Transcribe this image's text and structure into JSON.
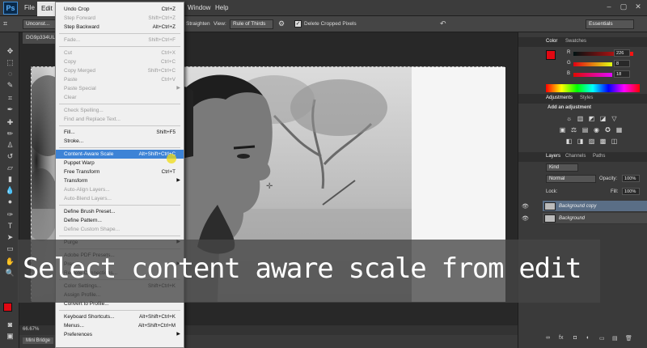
{
  "menubar": {
    "app_logo": "Ps",
    "items": [
      {
        "label": "File",
        "active": false
      },
      {
        "label": "Edit",
        "active": true
      },
      {
        "label": "Window",
        "active": false
      },
      {
        "label": "Help",
        "active": false
      }
    ],
    "window_controls": [
      "–",
      "▢",
      "✕"
    ]
  },
  "options_bar": {
    "ratio_value": "Unconst...",
    "straighten_label": "Straighten",
    "view_label": "View:",
    "view_value": "Rule of Thirds",
    "delete_cropped_label": "Delete Cropped Pixels",
    "workspace_value": "Essentials"
  },
  "document": {
    "tab_title": "DG9p334UL...",
    "zoom": "66.67%",
    "mini_bridge_label": "Mini Bridge"
  },
  "edit_menu": {
    "rows": [
      {
        "label": "Undo Crop",
        "shortcut": "Ctrl+Z",
        "state": "enabled"
      },
      {
        "label": "Step Forward",
        "shortcut": "Shift+Ctrl+Z",
        "state": "disabled"
      },
      {
        "label": "Step Backward",
        "shortcut": "Alt+Ctrl+Z",
        "state": "enabled"
      },
      {
        "sep": true
      },
      {
        "label": "Fade...",
        "shortcut": "Shift+Ctrl+F",
        "state": "disabled"
      },
      {
        "sep": true
      },
      {
        "label": "Cut",
        "shortcut": "Ctrl+X",
        "state": "disabled"
      },
      {
        "label": "Copy",
        "shortcut": "Ctrl+C",
        "state": "disabled"
      },
      {
        "label": "Copy Merged",
        "shortcut": "Shift+Ctrl+C",
        "state": "disabled"
      },
      {
        "label": "Paste",
        "shortcut": "Ctrl+V",
        "state": "disabled"
      },
      {
        "label": "Paste Special",
        "shortcut": "",
        "state": "disabled",
        "submenu": true
      },
      {
        "label": "Clear",
        "shortcut": "",
        "state": "disabled"
      },
      {
        "sep": true
      },
      {
        "label": "Check Spelling...",
        "shortcut": "",
        "state": "disabled"
      },
      {
        "label": "Find and Replace Text...",
        "shortcut": "",
        "state": "disabled"
      },
      {
        "sep": true
      },
      {
        "label": "Fill...",
        "shortcut": "Shift+F5",
        "state": "enabled"
      },
      {
        "label": "Stroke...",
        "shortcut": "",
        "state": "enabled"
      },
      {
        "sep": true
      },
      {
        "label": "Content-Aware Scale",
        "shortcut": "Alt+Shift+Ctrl+C",
        "state": "selected"
      },
      {
        "label": "Puppet Warp",
        "shortcut": "",
        "state": "enabled"
      },
      {
        "label": "Free Transform",
        "shortcut": "Ctrl+T",
        "state": "enabled"
      },
      {
        "label": "Transform",
        "shortcut": "",
        "state": "enabled",
        "submenu": true
      },
      {
        "label": "Auto-Align Layers...",
        "shortcut": "",
        "state": "disabled"
      },
      {
        "label": "Auto-Blend Layers...",
        "shortcut": "",
        "state": "disabled"
      },
      {
        "sep": true
      },
      {
        "label": "Define Brush Preset...",
        "shortcut": "",
        "state": "enabled"
      },
      {
        "label": "Define Pattern...",
        "shortcut": "",
        "state": "enabled"
      },
      {
        "label": "Define Custom Shape...",
        "shortcut": "",
        "state": "disabled"
      },
      {
        "sep": true
      },
      {
        "label": "Purge",
        "shortcut": "",
        "state": "enabled",
        "submenu": true
      },
      {
        "sep": true
      },
      {
        "label": "Adobe PDF Presets...",
        "shortcut": "",
        "state": "enabled"
      },
      {
        "label": "Presets",
        "shortcut": "",
        "state": "enabled",
        "submenu": true
      },
      {
        "label": "Remote Connections...",
        "shortcut": "",
        "state": "enabled"
      },
      {
        "sep": true
      },
      {
        "label": "Color Settings...",
        "shortcut": "Shift+Ctrl+K",
        "state": "enabled"
      },
      {
        "label": "Assign Profile...",
        "shortcut": "",
        "state": "enabled"
      },
      {
        "label": "Convert to Profile...",
        "shortcut": "",
        "state": "enabled"
      },
      {
        "sep": true
      },
      {
        "label": "Keyboard Shortcuts...",
        "shortcut": "Alt+Shift+Ctrl+K",
        "state": "enabled"
      },
      {
        "label": "Menus...",
        "shortcut": "Alt+Shift+Ctrl+M",
        "state": "enabled"
      },
      {
        "label": "Preferences",
        "shortcut": "",
        "state": "enabled",
        "submenu": true
      }
    ]
  },
  "caption": "Select content aware scale from edit",
  "color_panel": {
    "tabs": [
      "Color",
      "Swatches"
    ],
    "channels": [
      {
        "label": "R",
        "value": "226"
      },
      {
        "label": "G",
        "value": "8"
      },
      {
        "label": "B",
        "value": "18"
      }
    ],
    "foreground_color": "#e20812"
  },
  "adjustments_panel": {
    "tabs": [
      "Adjustments",
      "Styles"
    ],
    "title": "Add an adjustment",
    "icons_row1": [
      "☼",
      "▥",
      "◩",
      "◪",
      "▽"
    ],
    "icons_row2": [
      "▣",
      "⚖",
      "▤",
      "◉",
      "✪",
      "▦"
    ],
    "icons_row3": [
      "◧",
      "◨",
      "▨",
      "▩",
      "◫"
    ]
  },
  "layers_panel": {
    "tabs": [
      "Layers",
      "Channels",
      "Paths"
    ],
    "filter_value": "Kind",
    "blend_mode": "Normal",
    "opacity_label": "Opacity:",
    "opacity_value": "100%",
    "lock_label": "Lock:",
    "fill_label": "Fill:",
    "fill_value": "100%",
    "layers": [
      {
        "name": "Background copy",
        "selected": true
      },
      {
        "name": "Background",
        "selected": false
      }
    ],
    "bottom_icons": [
      "∞",
      "fx",
      "◘",
      "◐",
      "▭",
      "▤",
      "🗑"
    ]
  }
}
